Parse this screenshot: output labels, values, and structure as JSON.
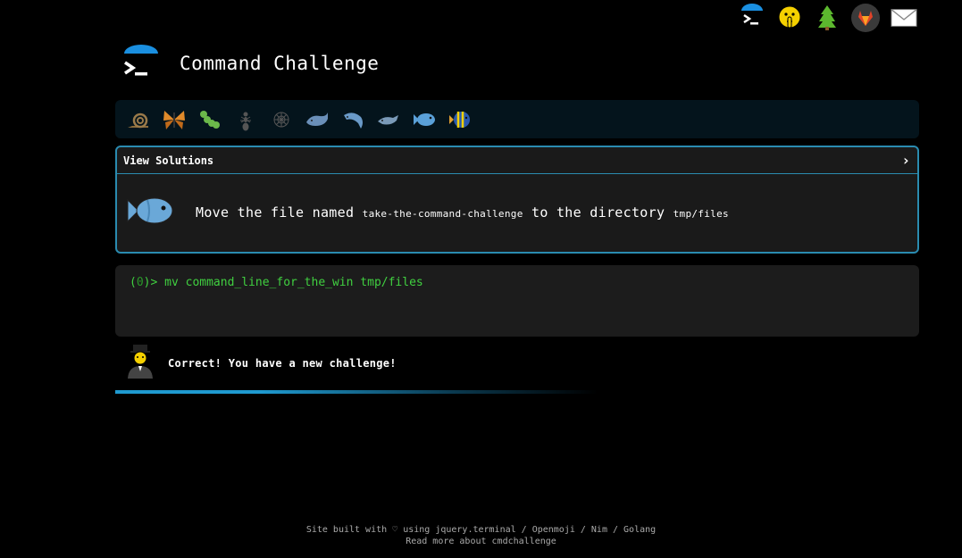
{
  "header": {
    "title": "Command Challenge"
  },
  "top_icons": [
    "terminal-icon",
    "shushing-face-icon",
    "tree-icon",
    "gitlab-icon",
    "mail-icon"
  ],
  "levels": [
    "snail-icon",
    "butterfly-icon",
    "caterpillar-icon",
    "ant-icon",
    "spider-web-icon",
    "whale-icon",
    "dolphin-icon",
    "dolphin-icon",
    "fish-icon",
    "tropical-fish-icon"
  ],
  "panel": {
    "view_solutions": "View Solutions",
    "chevron": "›",
    "challenge": {
      "prefix": "Move the file named",
      "file": "take-the-command-challenge",
      "middle": "to the directory",
      "dir": "tmp/files"
    }
  },
  "terminal": {
    "prompt_open": "(",
    "prompt_num": "0",
    "prompt_close": ")>",
    "command": "mv command_line_for_the_win tmp/files"
  },
  "feedback": {
    "text": "Correct! You have a new challenge!"
  },
  "footer": {
    "line1": "Site built with ♡ using jquery.terminal / Openmoji / Nim / Golang",
    "line2": "Read more about cmdchallenge"
  },
  "colors": {
    "accent": "#2a8bb0",
    "terminal_green": "#40d040",
    "background": "#000000"
  }
}
